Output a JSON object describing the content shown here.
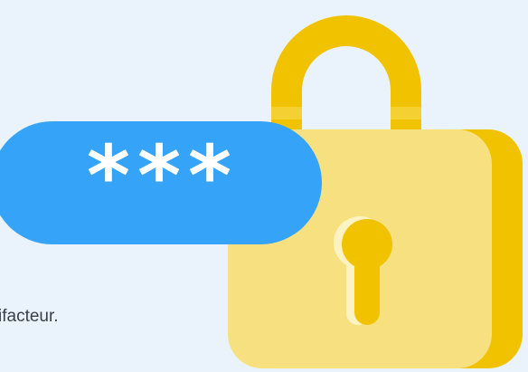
{
  "caption": {
    "text": "ifacteur."
  },
  "password_field": {
    "masked_value": "***",
    "color": "#35a3f8"
  },
  "padlock": {
    "body_color": "#f7e07f",
    "shade_color": "#f1c200",
    "shackle_color": "#f1c200",
    "keyhole_color": "#f1c200",
    "icon": "lock-icon"
  },
  "background": "#eaf3fb"
}
